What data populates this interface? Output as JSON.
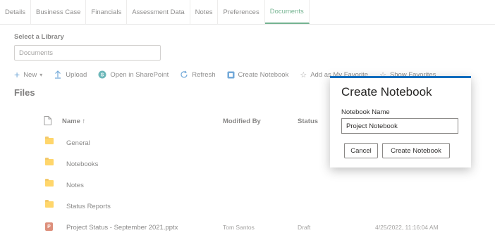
{
  "tabs": [
    "Details",
    "Business Case",
    "Financials",
    "Assessment Data",
    "Notes",
    "Preferences",
    "Documents"
  ],
  "active_tab": "Documents",
  "library": {
    "label": "Select a Library",
    "value": "Documents"
  },
  "commands": {
    "new": "New",
    "upload": "Upload",
    "open_sharepoint": "Open in SharePoint",
    "refresh": "Refresh",
    "create_notebook": "Create Notebook",
    "add_favorite": "Add as My Favorite",
    "show_favorites": "Show Favorites"
  },
  "files_title": "Files",
  "columns": {
    "name": "Name ↑",
    "modified_by": "Modified By",
    "status": "Status"
  },
  "rows": [
    {
      "name": "General",
      "type": "folder",
      "modified_by": "",
      "status": "",
      "date": ""
    },
    {
      "name": "Notebooks",
      "type": "folder",
      "modified_by": "",
      "status": "",
      "date": ""
    },
    {
      "name": "Notes",
      "type": "folder",
      "modified_by": "",
      "status": "",
      "date": ""
    },
    {
      "name": "Status Reports",
      "type": "folder",
      "modified_by": "",
      "status": "",
      "date": ""
    },
    {
      "name": "Project Status - September 2021.pptx",
      "type": "pptx",
      "modified_by": "Tom Santos",
      "status": "Draft",
      "date": "4/25/2022, 11:16:04 AM"
    }
  ],
  "dialog": {
    "title": "Create Notebook",
    "field_label": "Notebook Name",
    "field_value": "Project Notebook",
    "cancel": "Cancel",
    "confirm": "Create Notebook"
  },
  "colors": {
    "accent_green": "#107c41",
    "accent_blue": "#0f6cbd",
    "folder": "#ffb900",
    "pptx": "#c43e1c"
  }
}
